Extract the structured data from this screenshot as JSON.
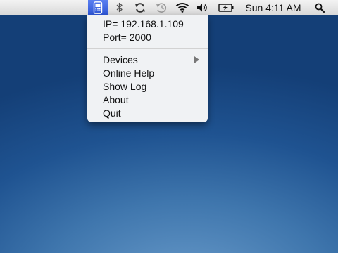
{
  "menubar": {
    "app_icon": "phone-remote-icon",
    "status_icons": [
      "bluetooth-icon",
      "sync-icon",
      "time-machine-icon",
      "wifi-icon",
      "volume-icon",
      "battery-icon",
      "spotlight-icon"
    ],
    "clock": "Sun 4:11 AM"
  },
  "menu": {
    "ip": "IP= 192.168.1.109",
    "port": "Port= 2000",
    "items": [
      {
        "label": "Devices",
        "has_submenu": true
      },
      {
        "label": "Online Help"
      },
      {
        "label": "Show Log"
      },
      {
        "label": "About"
      },
      {
        "label": "Quit"
      }
    ]
  },
  "colors": {
    "desktop": "#1f5391",
    "menubar": "#e6e6e6",
    "app_icon_highlight": "#3b63e0",
    "menu_bg": "#f8f8f8"
  }
}
